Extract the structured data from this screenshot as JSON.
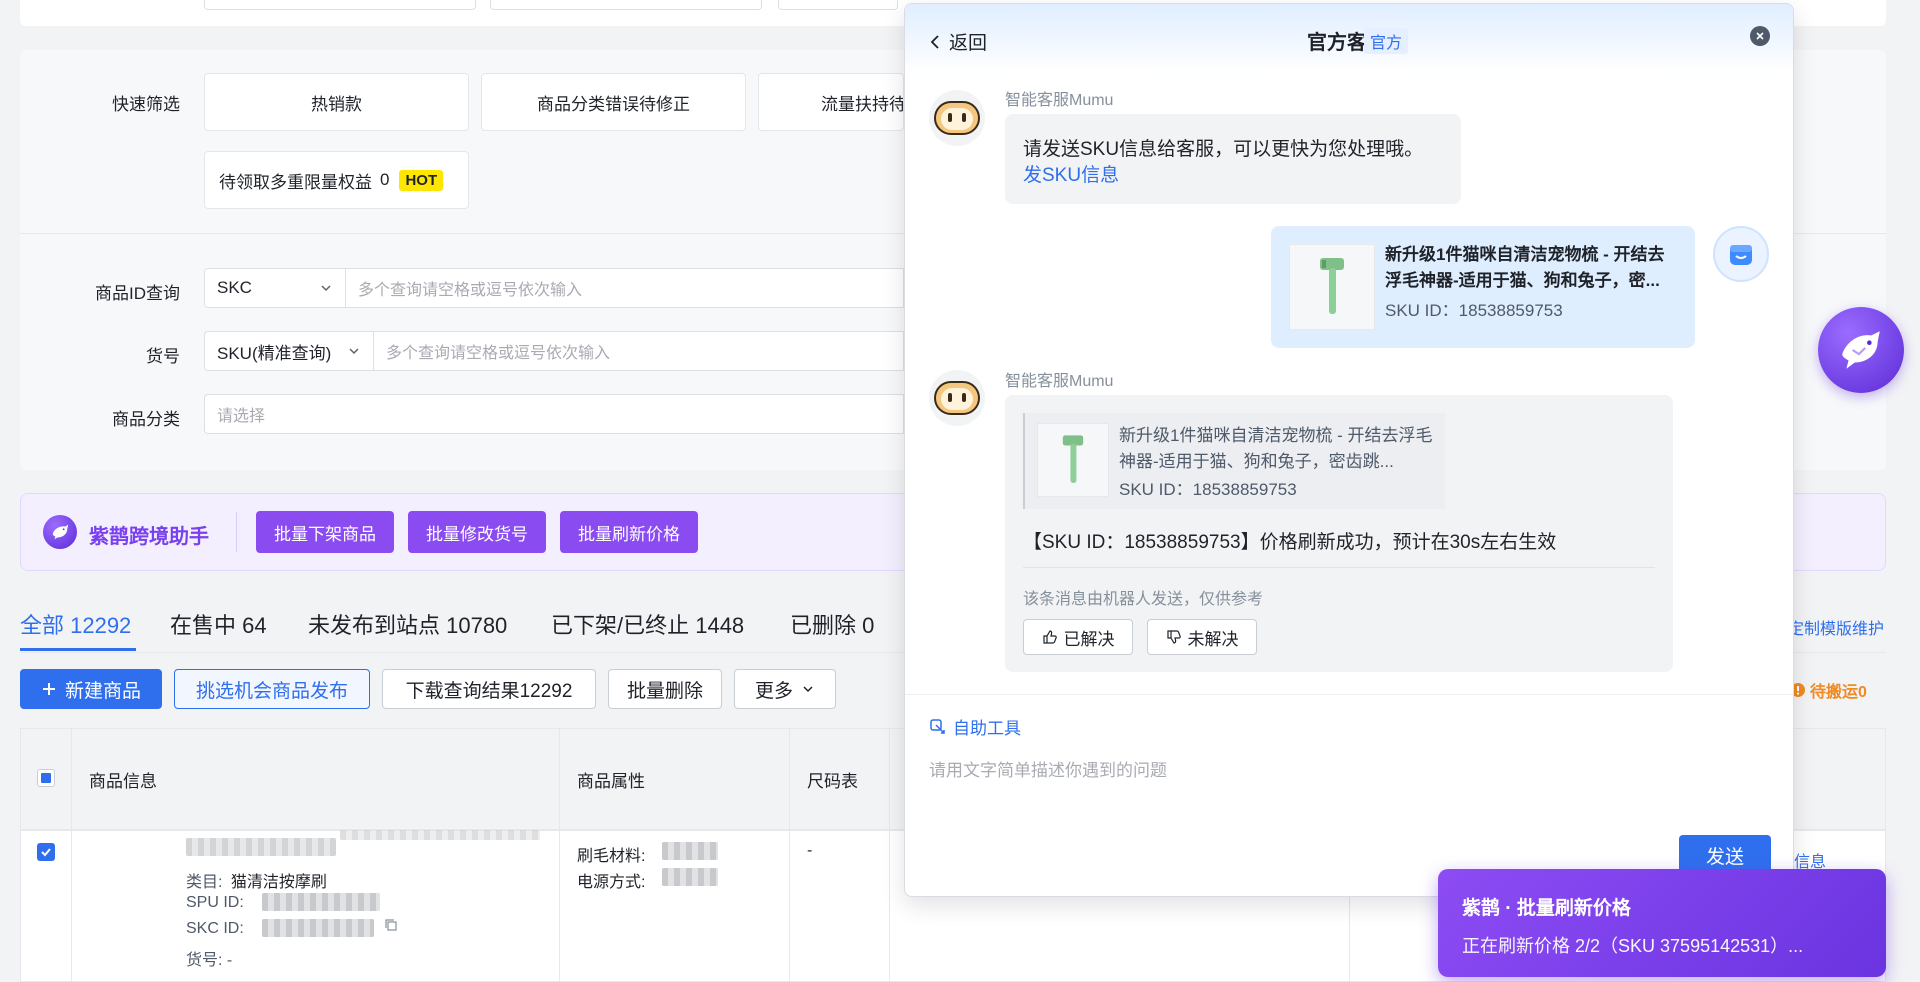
{
  "filters": {
    "quick_label": "快速筛选",
    "quick_chips": [
      "热销款",
      "商品分类错误待修正",
      "流量扶持待"
    ],
    "rights_chip": {
      "label": "待领取多重限量权益",
      "count": "0",
      "badge": "HOT"
    },
    "id_query": {
      "label": "商品ID查询",
      "select": "SKC",
      "placeholder": "多个查询请空格或逗号依次输入"
    },
    "sku_query": {
      "label": "货号",
      "select": "SKU(精准查询)",
      "placeholder": "多个查询请空格或逗号依次输入"
    },
    "category": {
      "label": "商品分类",
      "placeholder": "请选择"
    }
  },
  "assistant_bar": {
    "title": "紫鹊跨境助手",
    "buttons": [
      "批量下架商品",
      "批量修改货号",
      "批量刷新价格"
    ]
  },
  "tabs": [
    {
      "label": "全部 12292"
    },
    {
      "label": "在售中 64"
    },
    {
      "label": "未发布到站点 10780"
    },
    {
      "label": "已下架/已终止 1448"
    },
    {
      "label": "已删除 0"
    }
  ],
  "right_links": {
    "template": "定制模版维护",
    "pending": "待搬运0",
    "info": "信息"
  },
  "toolbar": {
    "new_product": "新建商品",
    "pick_publish": "挑选机会商品发布",
    "download": "下载查询结果12292",
    "batch_delete": "批量删除",
    "more": "更多"
  },
  "table": {
    "headers": [
      "商品信息",
      "商品属性",
      "尺码表"
    ],
    "row": {
      "category_label": "类目:",
      "category_value": "猫清洁按摩刷",
      "spu_label": "SPU ID:",
      "skc_label": "SKC ID:",
      "code_label": "货号: -",
      "attr1": "刷毛材料:",
      "attr2": "电源方式:",
      "size_value": "-"
    }
  },
  "chat": {
    "back": "返回",
    "title": "官方客服",
    "title_badge": "官方",
    "bot_name": "智能客服Mumu",
    "msg1": "请发送SKU信息给客服，可以更快为您处理哦。",
    "msg1_link": "发SKU信息",
    "product_title": "新升级1件猫咪自清洁宠物梳 - 开结去浮毛神器-适用于猫、狗和兔子，密...",
    "product_title_short": "新升级1件猫咪自清洁宠物梳 - 开结去浮毛神器-适用于猫、狗和兔子，密齿跳...",
    "sku_id": "SKU ID：18538859753",
    "reply": "【SKU ID：18538859753】价格刷新成功，预计在30s左右生效",
    "note": "该条消息由机器人发送，仅供参考",
    "solved": "已解决",
    "unsolved": "未解决",
    "self_tool": "自助工具",
    "input_placeholder": "请用文字简单描述你遇到的问题",
    "send": "发送"
  },
  "toast": {
    "title": "紫鹊 · 批量刷新价格",
    "body": "正在刷新价格 2/2（SKU 37595142531）..."
  },
  "colors": {
    "primary": "#2f6fed",
    "purple": "#8a4bf0",
    "hot": "#ffe600"
  }
}
